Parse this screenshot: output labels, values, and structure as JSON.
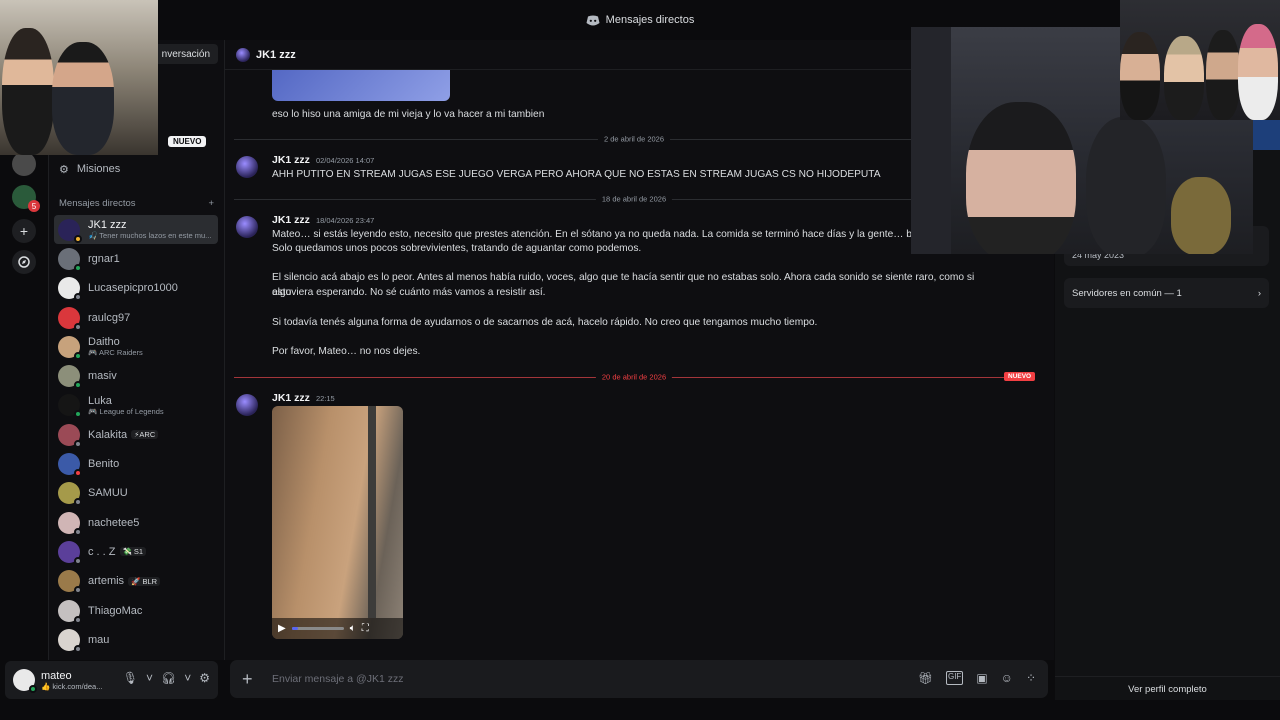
{
  "window": {
    "title": "Mensajes directos"
  },
  "sidebar": {
    "conversation_button": "nversación",
    "nuevo_pill": "NUEVO",
    "misiones_label": "Misiones",
    "dm_header": "Mensajes directos",
    "dm_add": "+",
    "items": [
      {
        "name": "JK1 zzz",
        "sub": "🎣 Tener muchos lazos en este mu...",
        "color": "#2a2358",
        "status": "#f0b232",
        "active": true
      },
      {
        "name": "rgnar1",
        "sub": "",
        "color": "#6a6f78",
        "status": "#23a55a"
      },
      {
        "name": "Lucasepicpro1000",
        "sub": "",
        "color": "#e9e9e9",
        "status": "#80848e"
      },
      {
        "name": "raulcg97",
        "sub": "",
        "color": "#da373c",
        "status": "#80848e"
      },
      {
        "name": "Daitho",
        "sub": "🎮 ARC Raiders",
        "color": "#c7a27c",
        "status": "#23a55a"
      },
      {
        "name": "masiv",
        "sub": "",
        "color": "#8c8f7a",
        "status": "#23a55a"
      },
      {
        "name": "Luka",
        "sub": "🎮 League of Legends",
        "color": "#151515",
        "status": "#23a55a"
      },
      {
        "name": "Kalakita",
        "tag": "⚡ARC",
        "sub": "",
        "color": "#9b4a56",
        "status": "#80848e"
      },
      {
        "name": "Benito",
        "sub": "",
        "color": "#3b5aa8",
        "status": "#f23f43"
      },
      {
        "name": "SAMUU",
        "sub": "",
        "color": "#a59a4a",
        "status": "#80848e"
      },
      {
        "name": "nachetee5",
        "sub": "",
        "color": "#d0b5b5",
        "status": "#80848e"
      },
      {
        "name": "c . . Z",
        "tag": "💸 S1",
        "sub": "",
        "color": "#5b3f9a",
        "status": "#80848e"
      },
      {
        "name": "artemis",
        "tag": "🚀 BLR",
        "sub": "",
        "color": "#9a7a4a",
        "status": "#80848e"
      },
      {
        "name": "ThiagoMac",
        "sub": "",
        "color": "#c4c0c0",
        "status": "#80848e"
      },
      {
        "name": "mau",
        "sub": "",
        "color": "#d9d4cf",
        "status": "#80848e"
      }
    ]
  },
  "user": {
    "name": "mateo",
    "status": "👍 kick.com/dea..."
  },
  "chat": {
    "header_name": "JK1 zzz",
    "earlier_text": "eso lo hiso una amiga de mi vieja y lo va hacer a mi tambien",
    "dividers": [
      "2 de abril de 2026",
      "18 de abril de 2026",
      "20 de abril de 2026"
    ],
    "new_label": "NUEVO",
    "messages": [
      {
        "author": "JK1 zzz",
        "time": "02/04/2026 14:07",
        "lines": [
          "AHH PUTITO EN STREAM JUGAS ESE JUEGO VERGA PERO AHORA QUE NO ESTAS EN STREAM JUGAS CS NO HIJODEPUTA"
        ]
      },
      {
        "author": "JK1 zzz",
        "time": "18/04/2026 23:47",
        "lines": [
          "Mateo… si estás leyendo esto, necesito que prestes atención. En el sótano ya no queda nada. La comida se terminó hace días y la gente… buen",
          "Solo quedamos unos pocos sobrevivientes, tratando de aguantar como podemos.",
          "El silencio acá abajo es lo peor. Antes al menos había ruido, voces, algo que te hacía sentir que no estabas solo. Ahora cada sonido se siente raro, como si algo",
          "estuviera esperando. No sé cuánto más vamos a resistir así.",
          "Si todavía tenés alguna forma de ayudarnos o de sacarnos de acá, hacelo rápido. No creo que tengamos mucho tiempo.",
          "Por favor, Mateo… no nos dejes."
        ]
      },
      {
        "author": "JK1 zzz",
        "time": "22:15",
        "lines": []
      }
    ],
    "video_progress": 0.12,
    "composer_placeholder": "Enviar mensaje a @JK1 zzz"
  },
  "profile": {
    "member_since": "24 may 2023",
    "common_servers": "Servidores en común — 1",
    "view_full": "Ver perfil completo"
  },
  "colors": {
    "accent": "#5865f2",
    "danger": "#f23f43"
  }
}
